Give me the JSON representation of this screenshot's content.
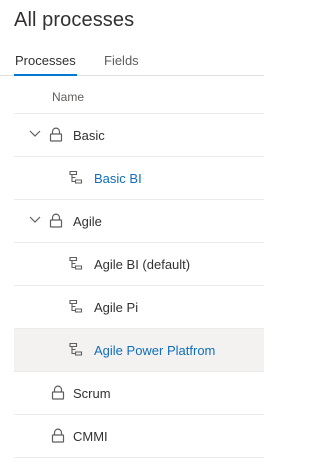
{
  "header": {
    "title": "All processes"
  },
  "tabs": [
    {
      "label": "Processes",
      "active": true
    },
    {
      "label": "Fields",
      "active": false
    }
  ],
  "table": {
    "column_name": "Name",
    "rows": [
      {
        "label": "Basic",
        "kind": "lock",
        "expanded": true,
        "indent": 0,
        "link": false,
        "selected": false
      },
      {
        "label": "Basic BI",
        "kind": "inherited",
        "indent": 1,
        "link": true,
        "selected": false
      },
      {
        "label": "Agile",
        "kind": "lock",
        "expanded": true,
        "indent": 0,
        "link": false,
        "selected": false
      },
      {
        "label": "Agile BI (default)",
        "kind": "inherited",
        "indent": 1,
        "link": false,
        "selected": false
      },
      {
        "label": "Agile Pi",
        "kind": "inherited",
        "indent": 1,
        "link": false,
        "selected": false
      },
      {
        "label": "Agile Power Platfrom",
        "kind": "inherited",
        "indent": 1,
        "link": true,
        "selected": true
      },
      {
        "label": "Scrum",
        "kind": "lock",
        "indent": 0,
        "link": false,
        "selected": false
      },
      {
        "label": "CMMI",
        "kind": "lock",
        "indent": 0,
        "link": false,
        "selected": false
      }
    ]
  },
  "colors": {
    "accent": "#0078d4",
    "link": "#106ebe",
    "text": "#323130",
    "selected_bg": "#f3f2f1"
  }
}
